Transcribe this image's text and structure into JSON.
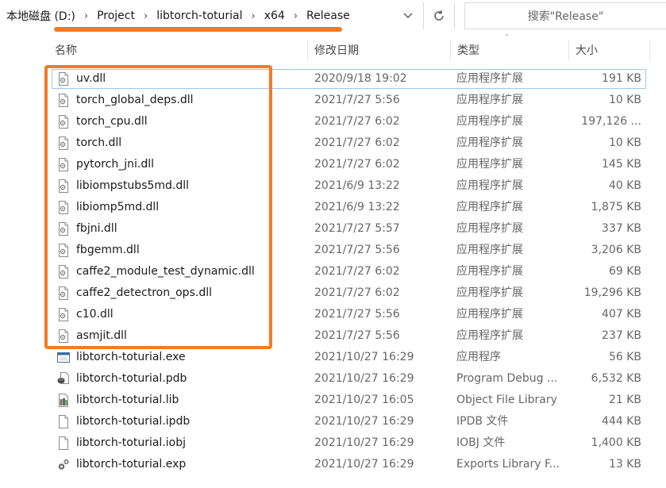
{
  "address_bar": {
    "breadcrumbs": [
      "本地磁盘 (D:)",
      "Project",
      "libtorch-toturial",
      "x64",
      "Release"
    ],
    "separator": "›",
    "dropdown_glyph": "⌄",
    "refresh_glyph": "↻"
  },
  "search": {
    "placeholder": "搜索\"Release\""
  },
  "columns": {
    "name": "名称",
    "date": "修改日期",
    "type": "类型",
    "size": "大小",
    "sort_indicator": "ˇ"
  },
  "files": [
    {
      "name": "uv.dll",
      "date": "2020/9/18 19:02",
      "type": "应用程序扩展",
      "size": "191 KB",
      "icon": "dll-file-icon",
      "selected": true
    },
    {
      "name": "torch_global_deps.dll",
      "date": "2021/7/27 5:56",
      "type": "应用程序扩展",
      "size": "10 KB",
      "icon": "dll-file-icon"
    },
    {
      "name": "torch_cpu.dll",
      "date": "2021/7/27 6:02",
      "type": "应用程序扩展",
      "size": "197,126 ...",
      "icon": "dll-file-icon"
    },
    {
      "name": "torch.dll",
      "date": "2021/7/27 6:02",
      "type": "应用程序扩展",
      "size": "10 KB",
      "icon": "dll-file-icon"
    },
    {
      "name": "pytorch_jni.dll",
      "date": "2021/7/27 6:02",
      "type": "应用程序扩展",
      "size": "145 KB",
      "icon": "dll-file-icon"
    },
    {
      "name": "libiompstubs5md.dll",
      "date": "2021/6/9 13:22",
      "type": "应用程序扩展",
      "size": "40 KB",
      "icon": "dll-file-icon"
    },
    {
      "name": "libiomp5md.dll",
      "date": "2021/6/9 13:22",
      "type": "应用程序扩展",
      "size": "1,875 KB",
      "icon": "dll-file-icon"
    },
    {
      "name": "fbjni.dll",
      "date": "2021/7/27 5:57",
      "type": "应用程序扩展",
      "size": "337 KB",
      "icon": "dll-file-icon"
    },
    {
      "name": "fbgemm.dll",
      "date": "2021/7/27 5:56",
      "type": "应用程序扩展",
      "size": "3,206 KB",
      "icon": "dll-file-icon"
    },
    {
      "name": "caffe2_module_test_dynamic.dll",
      "date": "2021/7/27 6:02",
      "type": "应用程序扩展",
      "size": "69 KB",
      "icon": "dll-file-icon"
    },
    {
      "name": "caffe2_detectron_ops.dll",
      "date": "2021/7/27 6:02",
      "type": "应用程序扩展",
      "size": "19,296 KB",
      "icon": "dll-file-icon"
    },
    {
      "name": "c10.dll",
      "date": "2021/7/27 5:56",
      "type": "应用程序扩展",
      "size": "407 KB",
      "icon": "dll-file-icon"
    },
    {
      "name": "asmjit.dll",
      "date": "2021/7/27 5:56",
      "type": "应用程序扩展",
      "size": "237 KB",
      "icon": "dll-file-icon"
    },
    {
      "name": "libtorch-toturial.exe",
      "date": "2021/10/27 16:29",
      "type": "应用程序",
      "size": "56 KB",
      "icon": "exe-file-icon"
    },
    {
      "name": "libtorch-toturial.pdb",
      "date": "2021/10/27 16:29",
      "type": "Program Debug ...",
      "size": "6,532 KB",
      "icon": "pdb-file-icon"
    },
    {
      "name": "libtorch-toturial.lib",
      "date": "2021/10/27 16:05",
      "type": "Object File Library",
      "size": "21 KB",
      "icon": "lib-file-icon"
    },
    {
      "name": "libtorch-toturial.ipdb",
      "date": "2021/10/27 16:29",
      "type": "IPDB 文件",
      "size": "444 KB",
      "icon": "blank-file-icon"
    },
    {
      "name": "libtorch-toturial.iobj",
      "date": "2021/10/27 16:29",
      "type": "IOBJ 文件",
      "size": "1,400 KB",
      "icon": "blank-file-icon"
    },
    {
      "name": "libtorch-toturial.exp",
      "date": "2021/10/27 16:29",
      "type": "Exports Library F...",
      "size": "13 KB",
      "icon": "exp-file-icon"
    }
  ],
  "colors": {
    "annotation": "#f47a24",
    "selection_border": "#99c9ef"
  }
}
